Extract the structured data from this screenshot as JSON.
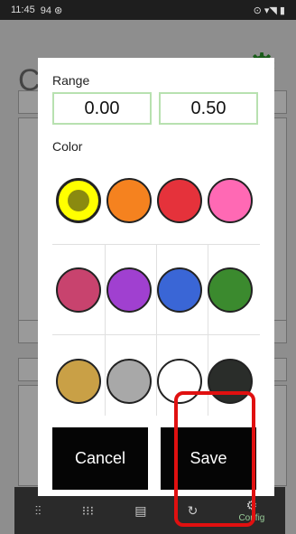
{
  "status_bar": {
    "time": "11:45",
    "left_icons": "94 ⊛",
    "right_icons": "⊙ ▾◥ ▮"
  },
  "background": {
    "title": "C",
    "nav": [
      {
        "icon": "⫶⫶",
        "label": ""
      },
      {
        "icon": "⁝⁝⁝",
        "label": ""
      },
      {
        "icon": "▤",
        "label": ""
      },
      {
        "icon": "↻",
        "label": ""
      },
      {
        "icon": "⚙",
        "label": "Config"
      }
    ]
  },
  "dialog": {
    "range_label": "Range",
    "range_min": "0.00",
    "range_max": "0.50",
    "color_label": "Color",
    "swatches": [
      {
        "color": "#ffff00",
        "selected": true
      },
      {
        "color": "#f5821f"
      },
      {
        "color": "#e5323b"
      },
      {
        "color": "#ff69b4"
      },
      {
        "color": "#c8436e"
      },
      {
        "color": "#a040d0"
      },
      {
        "color": "#3a66d6"
      },
      {
        "color": "#3b8a2e"
      },
      {
        "color": "#c9a046"
      },
      {
        "color": "#a8a8a8"
      },
      {
        "color": "#ffffff"
      },
      {
        "color": "#2a2d2a"
      }
    ],
    "cancel_label": "Cancel",
    "save_label": "Save"
  }
}
